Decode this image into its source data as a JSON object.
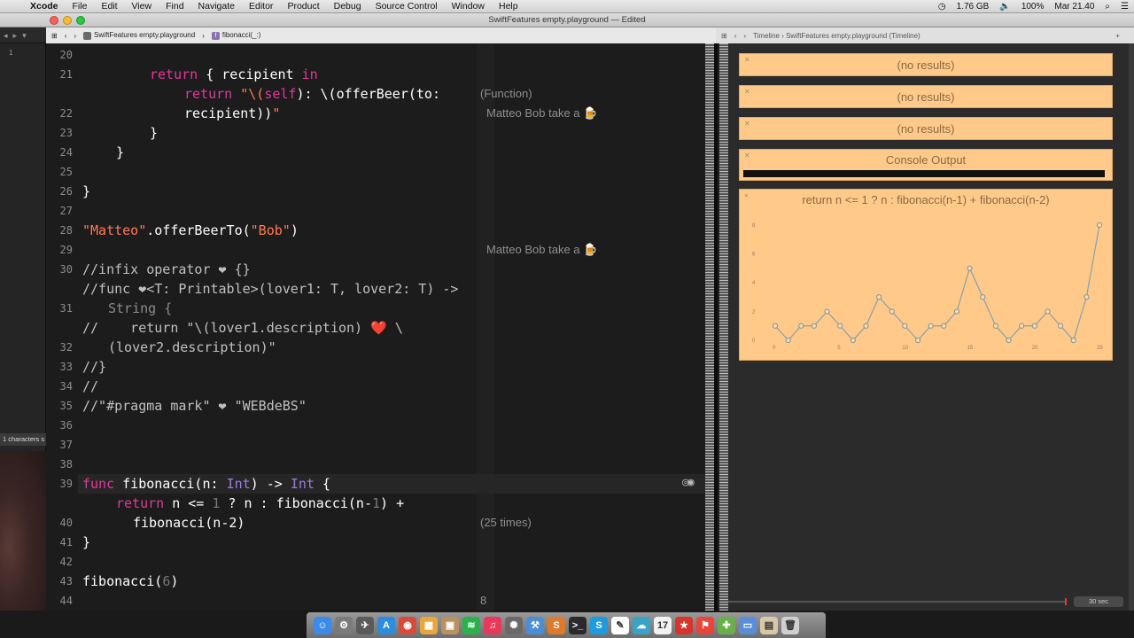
{
  "menubar": {
    "apple_glyph": "",
    "app_name": "Xcode",
    "items": [
      "File",
      "Edit",
      "View",
      "Find",
      "Navigate",
      "Editor",
      "Product",
      "Debug",
      "Source Control",
      "Window",
      "Help"
    ],
    "memory": "1.76 GB",
    "battery": "100%",
    "datetime": "Mar 21.40"
  },
  "window": {
    "title": "SwiftFeatures empty.playground — Edited"
  },
  "jumpbar": {
    "editor_file": "SwiftFeatures empty.playground",
    "editor_symbol": "fibonacci(_:)",
    "assistant_path": "Timeline › SwiftFeatures empty.playground (Timeline)"
  },
  "navigator": {
    "line_indicator": "1",
    "status": "1 characters s"
  },
  "editor": {
    "lines": [
      {
        "n": "20",
        "top": 2
      },
      {
        "n": "21",
        "top": 24
      },
      {
        "n": "",
        "top": 46
      },
      {
        "n": "22",
        "top": 68
      },
      {
        "n": "23",
        "top": 90
      },
      {
        "n": "24",
        "top": 112
      },
      {
        "n": "25",
        "top": 134
      },
      {
        "n": "26",
        "top": 156
      },
      {
        "n": "27",
        "top": 178
      },
      {
        "n": "28",
        "top": 200
      },
      {
        "n": "29",
        "top": 222
      },
      {
        "n": "30",
        "top": 244
      },
      {
        "n": "",
        "top": 266
      },
      {
        "n": "31",
        "top": 288
      },
      {
        "n": "",
        "top": 310
      },
      {
        "n": "32",
        "top": 332
      },
      {
        "n": "33",
        "top": 354
      },
      {
        "n": "34",
        "top": 376
      },
      {
        "n": "35",
        "top": 398
      },
      {
        "n": "36",
        "top": 420
      },
      {
        "n": "37",
        "top": 442
      },
      {
        "n": "38",
        "top": 464
      },
      {
        "n": "39",
        "top": 486
      },
      {
        "n": "",
        "top": 508
      },
      {
        "n": "40",
        "top": 530
      },
      {
        "n": "41",
        "top": 552
      },
      {
        "n": "42",
        "top": 574
      },
      {
        "n": "43",
        "top": 596
      },
      {
        "n": "44",
        "top": 618
      }
    ],
    "code": {
      "l20_kw": "return",
      "l20_rest": " { recipient ",
      "l20_in": "in",
      "l21_kw": "return",
      "l21_str": "\"\\(",
      "l21_self": "self",
      "l21_str2": "): \\(",
      "l21_rest": "offerBeer(to:",
      "l21b": "recipient))",
      "l21b_str": "\"",
      "l22": "}",
      "l23": "}",
      "l25": "}",
      "l27_str": "\"Matteo\"",
      "l27_call": ".offerBeerTo(",
      "l27_arg": "\"Bob\"",
      "l27_end": ")",
      "l29": "//infix operator ❤ {}",
      "l30": "//func ❤<T: Printable>(lover1: T, lover2: T) ->",
      "l30b": "String {",
      "l31": "//    return \"\\(lover1.description) ❤️ \\",
      "l31b": "(lover2.description)\"",
      "l32": "//}",
      "l33": "//",
      "l34": "//\"#pragma mark\" ❤ \"WEBdeBS\"",
      "l38_kw": "func",
      "l38_name": " fibonacci(n: ",
      "l38_type": "Int",
      "l38_arrow": ") -> ",
      "l38_type2": "Int",
      "l38_end": " {",
      "l39_kw": "return",
      "l39_a": " n <= ",
      "l39_one": "1",
      "l39_b": " ? n : ",
      "l39_call": "fibonacci(n-",
      "l39_one2": "1",
      "l39_c": ") +",
      "l39b": "fibonacci(n-2)",
      "l40": "}",
      "l42_call": "fibonacci(",
      "l42_arg": "6",
      "l42_end": ")"
    },
    "results": {
      "r20": "(Function)",
      "r21": "Matteo Bob take a 🍺",
      "r27": "Matteo Bob take a 🍺",
      "r39": "(25 times)",
      "r42": "8"
    }
  },
  "assistant": {
    "result1": "(no results)",
    "result2": "(no results)",
    "result3": "(no results)",
    "console_title": "Console Output",
    "graph_title": "return n <= 1 ? n : fibonacci(n-1) + fibonacci(n-2)",
    "timeline_value": "30 sec"
  },
  "chart_data": {
    "type": "line",
    "title": "return n <= 1 ? n : fibonacci(n-1) + fibonacci(n-2)",
    "xlabel": "",
    "ylabel": "",
    "x_ticks": [
      "0",
      "5",
      "10",
      "15",
      "20",
      "25"
    ],
    "y_ticks": [
      "0",
      "2",
      "4",
      "6",
      "8"
    ],
    "xlim": [
      0,
      25
    ],
    "ylim": [
      0,
      8
    ],
    "series": [
      {
        "values": [
          1,
          0,
          1,
          1,
          2,
          1,
          0,
          1,
          3,
          2,
          1,
          0,
          1,
          1,
          2,
          5,
          3,
          1,
          0,
          1,
          1,
          2,
          1,
          0,
          3,
          8
        ]
      }
    ],
    "grid": false,
    "legend": "none"
  },
  "dock": {
    "icons": [
      {
        "name": "finder-icon",
        "glyph": "☺",
        "color": "#3d8be8"
      },
      {
        "name": "system-prefs-icon",
        "glyph": "⚙",
        "color": "#7a7a7a"
      },
      {
        "name": "launchpad-icon",
        "glyph": "✈",
        "color": "#5a5a5a"
      },
      {
        "name": "app-store-icon",
        "glyph": "A",
        "color": "#2d8ce0"
      },
      {
        "name": "chrome-icon",
        "glyph": "◉",
        "color": "#d84b3b"
      },
      {
        "name": "grid-app-icon",
        "glyph": "▦",
        "color": "#e8a63b"
      },
      {
        "name": "preview-icon",
        "glyph": "▣",
        "color": "#b89260"
      },
      {
        "name": "spotify-icon",
        "glyph": "≋",
        "color": "#2ab24a"
      },
      {
        "name": "itunes-icon",
        "glyph": "♫",
        "color": "#e8395a"
      },
      {
        "name": "photo-app-icon",
        "glyph": "✺",
        "color": "#6a6a6a"
      },
      {
        "name": "xcode-icon",
        "glyph": "⚒",
        "color": "#4b8ed8"
      },
      {
        "name": "sublime-icon",
        "glyph": "S",
        "color": "#e07a2b"
      },
      {
        "name": "terminal-icon",
        "glyph": ">_",
        "color": "#2a2a2a"
      },
      {
        "name": "skype-icon",
        "glyph": "S",
        "color": "#1d9ae0"
      },
      {
        "name": "paint-app-icon",
        "glyph": "✎",
        "color": "#ffffff"
      },
      {
        "name": "messages-icon",
        "glyph": "☁",
        "color": "#3aa3c8"
      },
      {
        "name": "calendar-icon",
        "glyph": "17",
        "color": "#f2f2f2"
      },
      {
        "name": "bookmark-app-icon",
        "glyph": "★",
        "color": "#d8342b"
      },
      {
        "name": "flag-app-icon",
        "glyph": "⚑",
        "color": "#e8453b"
      },
      {
        "name": "colorful-app-icon",
        "glyph": "✚",
        "color": "#6ab04a"
      },
      {
        "name": "folder-icon",
        "glyph": "▭",
        "color": "#5a8fd8"
      },
      {
        "name": "documents-icon",
        "glyph": "▤",
        "color": "#d8c8a8"
      },
      {
        "name": "trash-icon",
        "glyph": "🗑",
        "color": "#cfcfcf"
      }
    ]
  }
}
